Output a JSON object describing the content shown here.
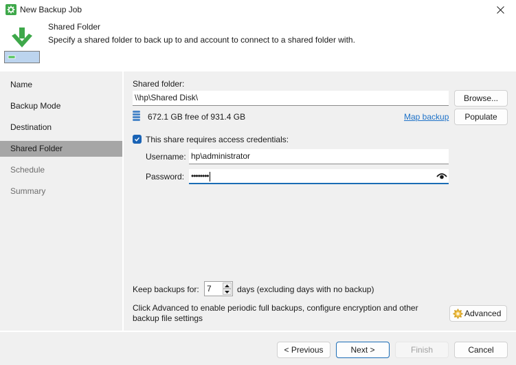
{
  "window": {
    "title": "New Backup Job",
    "app_icon": "gear-icon",
    "close_icon": "close-icon"
  },
  "header": {
    "title": "Shared Folder",
    "description": "Specify a shared folder to back up to and account to connect to a shared folder with.",
    "icon": "download-to-drive-icon"
  },
  "sidebar": {
    "items": [
      {
        "label": "Name",
        "state": "normal"
      },
      {
        "label": "Backup Mode",
        "state": "normal"
      },
      {
        "label": "Destination",
        "state": "normal"
      },
      {
        "label": "Shared Folder",
        "state": "active"
      },
      {
        "label": "Schedule",
        "state": "disabled"
      },
      {
        "label": "Summary",
        "state": "disabled"
      }
    ]
  },
  "shared_folder": {
    "label": "Shared folder:",
    "value": "\\\\hp\\Shared Disk\\",
    "browse_label": "Browse...",
    "free_space": "672.1 GB free of 931.4 GB",
    "map_backup_label": "Map backup",
    "populate_label": "Populate"
  },
  "credentials": {
    "checkbox_label": "This share requires access credentials:",
    "checked": true,
    "username_label": "Username:",
    "username_value": "hp\\administrator",
    "password_label": "Password:",
    "password_value": "••••••••",
    "reveal_icon": "eye-icon"
  },
  "retention": {
    "label": "Keep backups for:",
    "value": "7",
    "suffix": "days (excluding days with no backup)"
  },
  "advanced": {
    "description": "Click Advanced to enable periodic full backups, configure encryption and other backup file settings",
    "button_label": "Advanced"
  },
  "footer": {
    "previous_label": "< Previous",
    "next_label": "Next >",
    "finish_label": "Finish",
    "cancel_label": "Cancel"
  },
  "colors": {
    "accent": "#1a63b5",
    "link": "#1e72c8",
    "brand_green": "#3ea84a",
    "sidebar_active": "#a6a6a6"
  }
}
